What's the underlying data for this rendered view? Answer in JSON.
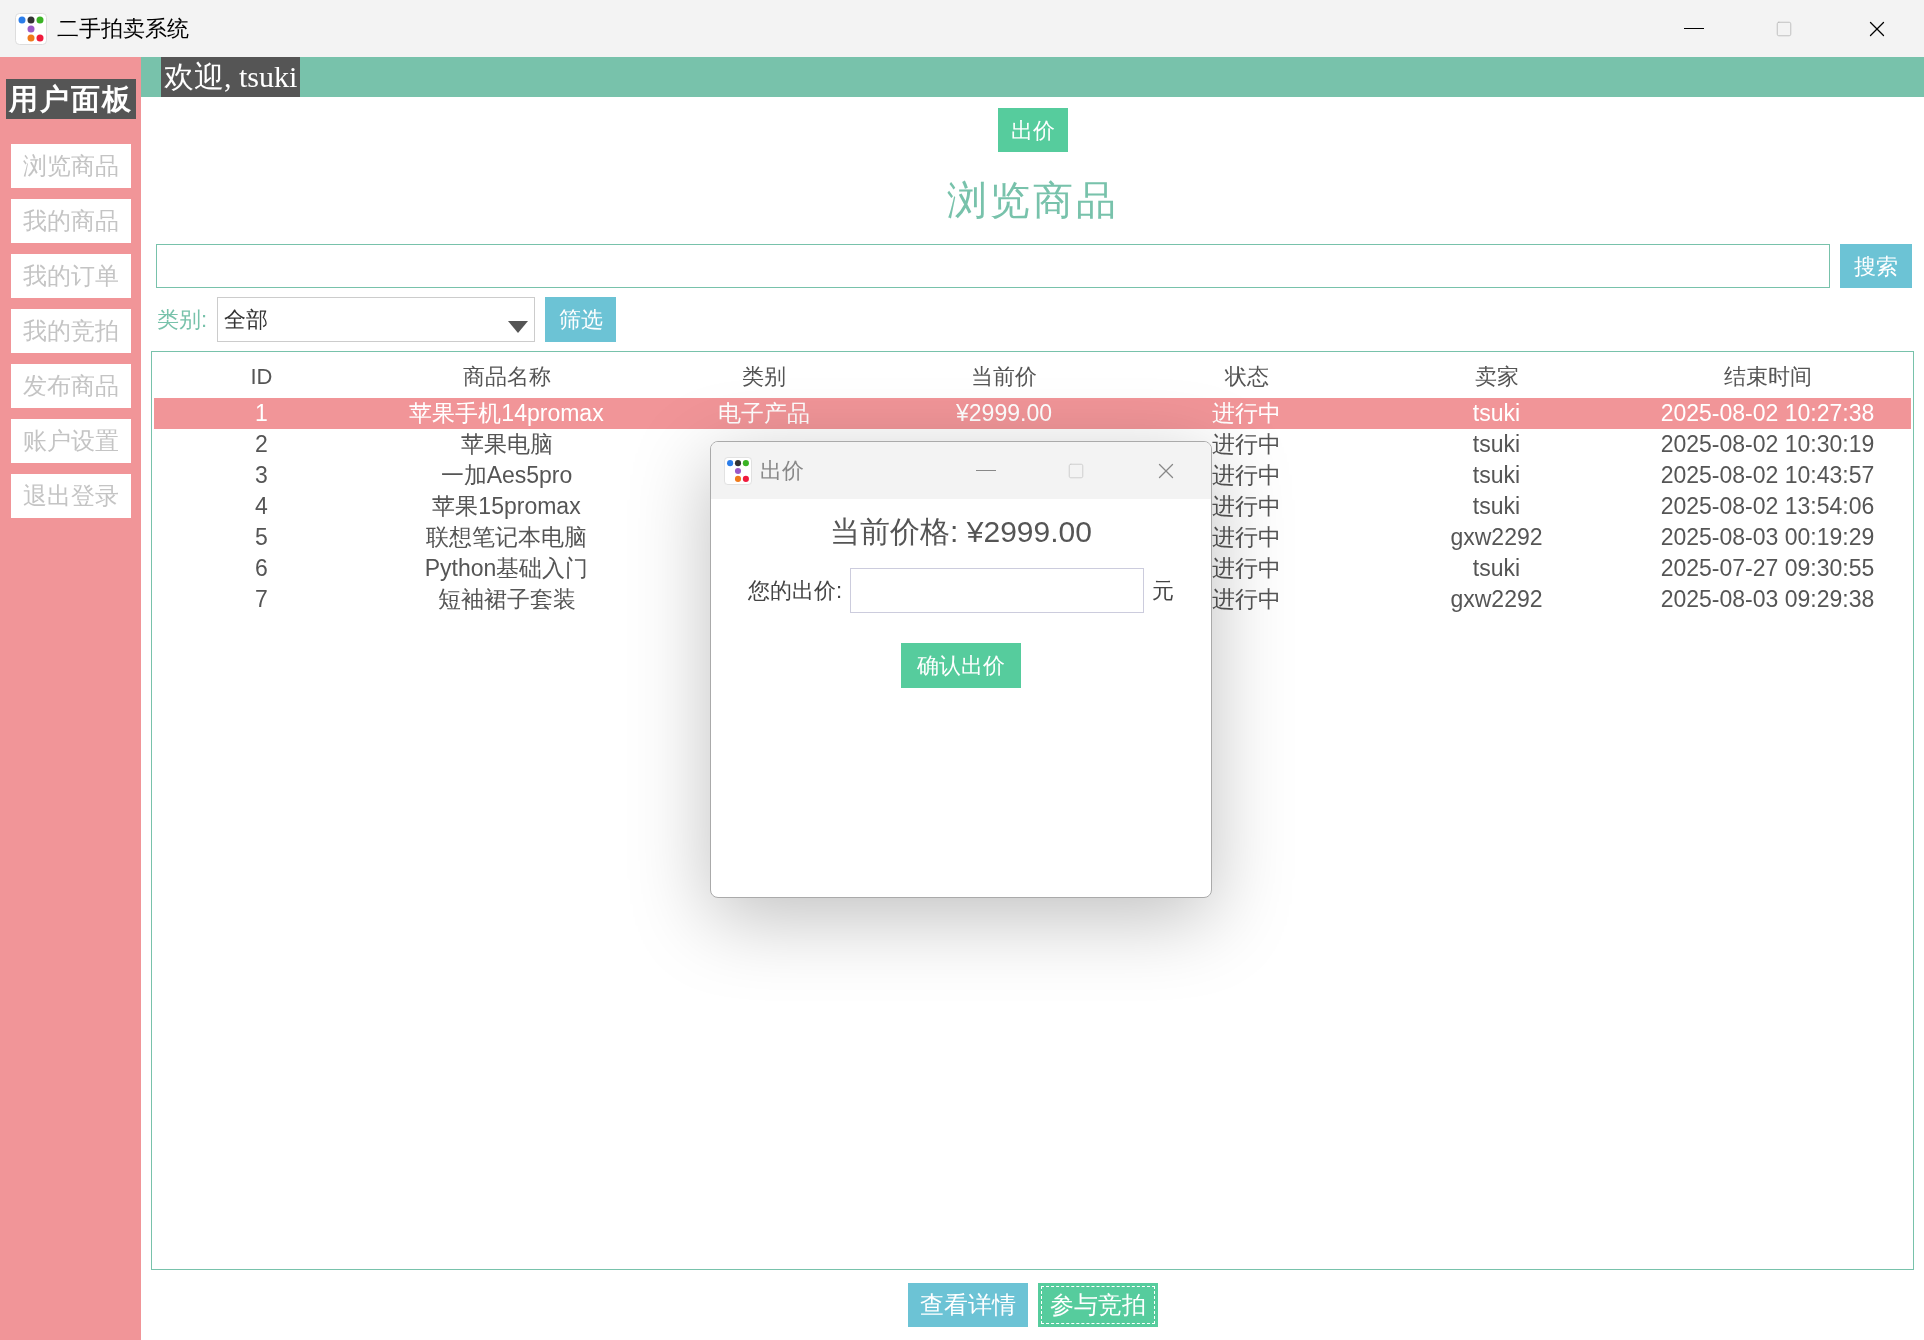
{
  "window": {
    "title": "二手拍卖系统"
  },
  "sidebar": {
    "title": "用户面板",
    "items": [
      {
        "label": "浏览商品"
      },
      {
        "label": "我的商品"
      },
      {
        "label": "我的订单"
      },
      {
        "label": "我的竞拍"
      },
      {
        "label": "发布商品"
      },
      {
        "label": "账户设置"
      },
      {
        "label": "退出登录"
      }
    ]
  },
  "welcome": "欢迎, tsuki",
  "bid_button": "出价",
  "page_title": "浏览商品",
  "search": {
    "button": "搜索"
  },
  "filter": {
    "label": "类别:",
    "value": "全部",
    "button": "筛选"
  },
  "table": {
    "columns": [
      "ID",
      "商品名称",
      "类别",
      "当前价",
      "状态",
      "卖家",
      "结束时间"
    ],
    "rows": [
      {
        "selected": true,
        "cells": [
          "1",
          "苹果手机14promax",
          "电子产品",
          "¥2999.00",
          "进行中",
          "tsuki",
          "2025-08-02 10:27:38"
        ]
      },
      {
        "selected": false,
        "cells": [
          "2",
          "苹果电脑",
          null,
          null,
          "进行中",
          "tsuki",
          "2025-08-02 10:30:19"
        ]
      },
      {
        "selected": false,
        "cells": [
          "3",
          "一加Aes5pro",
          null,
          null,
          "进行中",
          "tsuki",
          "2025-08-02 10:43:57"
        ]
      },
      {
        "selected": false,
        "cells": [
          "4",
          "苹果15promax",
          null,
          null,
          "进行中",
          "tsuki",
          "2025-08-02 13:54:06"
        ]
      },
      {
        "selected": false,
        "cells": [
          "5",
          "联想笔记本电脑",
          null,
          null,
          "进行中",
          "gxw2292",
          "2025-08-03 00:19:29"
        ]
      },
      {
        "selected": false,
        "cells": [
          "6",
          "Python基础入门",
          null,
          null,
          "进行中",
          "tsuki",
          "2025-07-27 09:30:55"
        ]
      },
      {
        "selected": false,
        "cells": [
          "7",
          "短袖裙子套装",
          null,
          null,
          "进行中",
          "gxw2292",
          "2025-08-03 09:29:38"
        ]
      }
    ]
  },
  "bottom_buttons": [
    {
      "label": "查看详情",
      "kind": "detail"
    },
    {
      "label": "参与竞拍",
      "kind": "bid"
    }
  ],
  "dialog": {
    "title": "出价",
    "current_price": "当前价格: ¥2999.00",
    "bid_label": "您的出价:",
    "unit": "元",
    "confirm": "确认出价"
  }
}
